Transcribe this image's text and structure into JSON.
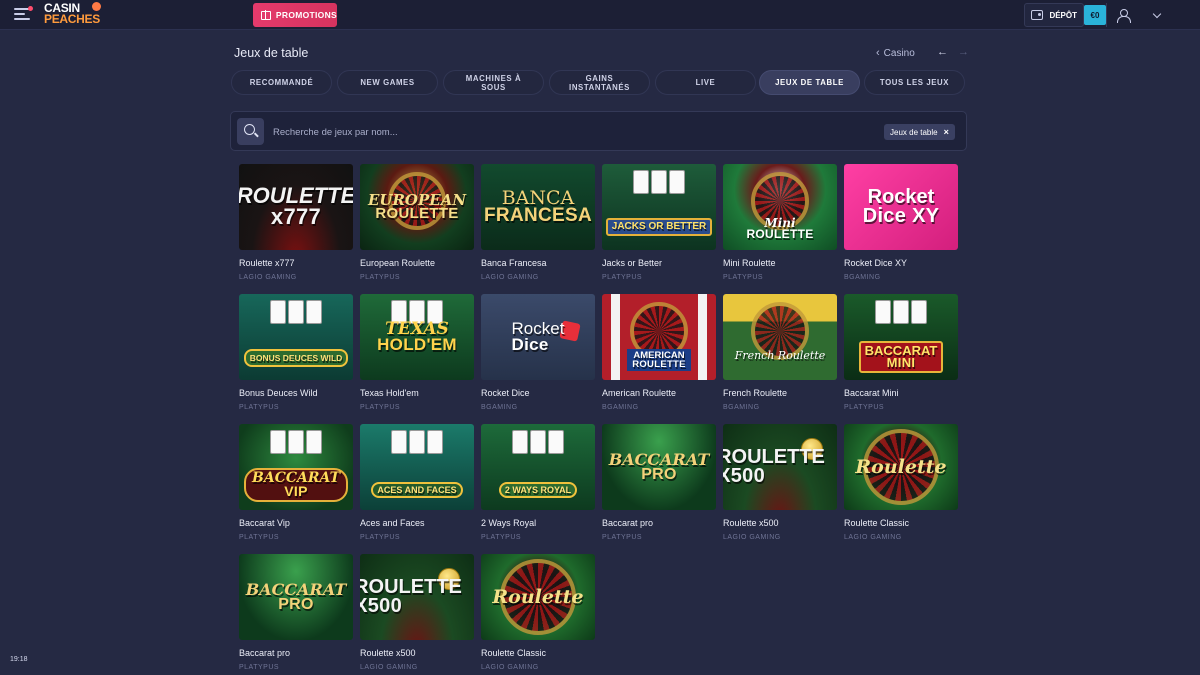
{
  "header": {
    "logo_line1": "CASIN",
    "logo_line2": "PEACHES",
    "promotions_label": "PROMOTIONS",
    "deposit_label": "DÉPÔT",
    "balance": "€0"
  },
  "page": {
    "title": "Jeux de table",
    "breadcrumb_back": "Casino",
    "prev_arrow": "←",
    "next_arrow": "→"
  },
  "tabs": [
    {
      "label": "RECOMMANDÉ",
      "active": false
    },
    {
      "label": "NEW GAMES",
      "active": false
    },
    {
      "label": "MACHINES À SOUS",
      "active": false
    },
    {
      "label": "GAINS INSTANTANÉS",
      "active": false
    },
    {
      "label": "LIVE",
      "active": false
    },
    {
      "label": "JEUX DE TABLE",
      "active": true
    },
    {
      "label": "TOUS LES JEUX",
      "active": false
    }
  ],
  "search": {
    "placeholder": "Recherche de jeux par nom...",
    "filter_chip": "Jeux de table",
    "filter_remove": "×"
  },
  "games": [
    {
      "name": "Roulette x777",
      "provider": "LAGIO GAMING",
      "art": "ROULETTE",
      "art_sub": "x777",
      "style": "roulette777"
    },
    {
      "name": "European Roulette",
      "provider": "PLATYPUS",
      "art": "EUROPEAN",
      "art_sub": "ROULETTE",
      "style": "euroulette"
    },
    {
      "name": "Banca Francesa",
      "provider": "LAGIO GAMING",
      "art": "BANCA",
      "art_sub": "FRANCESA",
      "style": "banca"
    },
    {
      "name": "Jacks or Better",
      "provider": "PLATYPUS",
      "art": "JACKS OR BETTER",
      "art_sub": "",
      "style": "jacks"
    },
    {
      "name": "Mini Roulette",
      "provider": "PLATYPUS",
      "art": "Mini",
      "art_sub": "ROULETTE",
      "style": "miniroul"
    },
    {
      "name": "Rocket Dice XY",
      "provider": "BGAMING",
      "art": "Rocket",
      "art_sub": "Dice XY",
      "style": "rocketxy"
    },
    {
      "name": "Bonus Deuces Wild",
      "provider": "PLATYPUS",
      "art": "BONUS DEUCES WILD",
      "art_sub": "",
      "style": "bonusdeuces"
    },
    {
      "name": "Texas Hold'em",
      "provider": "PLATYPUS",
      "art": "TEXAS",
      "art_sub": "HOLD'EM",
      "style": "texas"
    },
    {
      "name": "Rocket Dice",
      "provider": "BGAMING",
      "art": "Rocket",
      "art_sub": "Dice",
      "style": "rocketdice"
    },
    {
      "name": "American Roulette",
      "provider": "BGAMING",
      "art": "AMERICAN",
      "art_sub": "ROULETTE",
      "style": "american"
    },
    {
      "name": "French Roulette",
      "provider": "BGAMING",
      "art": "French Roulette",
      "art_sub": "",
      "style": "french"
    },
    {
      "name": "Baccarat Mini",
      "provider": "PLATYPUS",
      "art": "BACCARAT",
      "art_sub": "MINI",
      "style": "baccmini"
    },
    {
      "name": "Baccarat Vip",
      "provider": "PLATYPUS",
      "art": "BACCARAT",
      "art_sub": "VIP",
      "style": "baccvip"
    },
    {
      "name": "Aces and Faces",
      "provider": "PLATYPUS",
      "art": "ACES AND FACES",
      "art_sub": "",
      "style": "acesfaces"
    },
    {
      "name": "2 Ways Royal",
      "provider": "PLATYPUS",
      "art": "2 WAYS ROYAL",
      "art_sub": "",
      "style": "2ways"
    },
    {
      "name": "Baccarat pro",
      "provider": "PLATYPUS",
      "art": "BACCARAT",
      "art_sub": "PRO",
      "style": "baccpro"
    },
    {
      "name": "Roulette x500",
      "provider": "LAGIO GAMING",
      "art": "ROULETTE",
      "art_sub": "X500",
      "style": "roul500"
    },
    {
      "name": "Roulette Classic",
      "provider": "LAGIO GAMING",
      "art": "Roulette",
      "art_sub": "",
      "style": "roulclassic"
    },
    {
      "name": "Baccarat pro",
      "provider": "PLATYPUS",
      "art": "BACCARAT",
      "art_sub": "PRO",
      "style": "baccpro"
    },
    {
      "name": "Roulette x500",
      "provider": "LAGIO GAMING",
      "art": "ROULETTE",
      "art_sub": "X500",
      "style": "roul500"
    },
    {
      "name": "Roulette Classic",
      "provider": "LAGIO GAMING",
      "art": "Roulette",
      "art_sub": "",
      "style": "roulclassic"
    }
  ],
  "clock": "19:18",
  "colors": {
    "background": "#252943",
    "topbar": "#1c1f35",
    "promo_accent": "#e43a6c",
    "balance_accent": "#2ab3d9",
    "active_tab": "#393e5f"
  }
}
